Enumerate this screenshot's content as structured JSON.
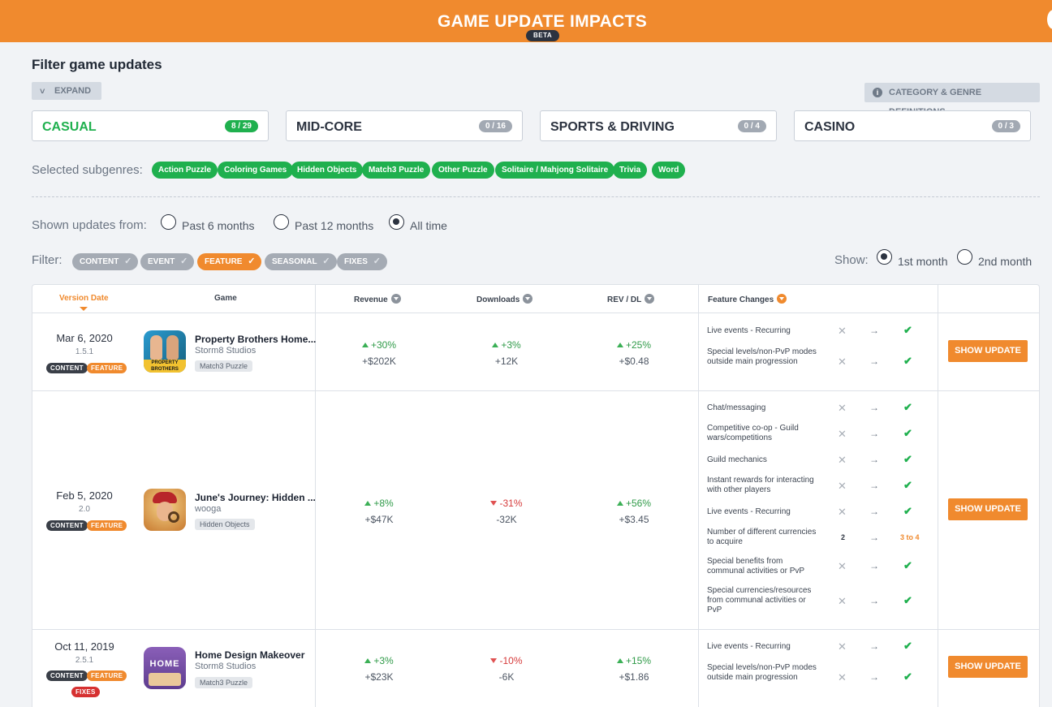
{
  "header": {
    "title": "GAME UPDATE IMPACTS",
    "beta": "BETA"
  },
  "filters": {
    "heading": "Filter game updates",
    "expand": "EXPAND",
    "definitions": "CATEGORY & GENRE DEFINITIONS",
    "categories": [
      {
        "name": "CASUAL",
        "count": "8 / 29",
        "active": true
      },
      {
        "name": "MID-CORE",
        "count": "0 / 16",
        "active": false
      },
      {
        "name": "SPORTS & DRIVING",
        "count": "0 / 4",
        "active": false
      },
      {
        "name": "CASINO",
        "count": "0 / 3",
        "active": false
      }
    ],
    "subgenres_label": "Selected subgenres:",
    "subgenres": [
      "Action Puzzle",
      "Coloring Games",
      "Hidden Objects",
      "Match3 Puzzle",
      "Other Puzzle",
      "Solitaire / Mahjong Solitaire",
      "Trivia",
      "Word"
    ],
    "shown_label": "Shown updates from:",
    "periods": [
      "Past 6 months",
      "Past 12 months",
      "All time"
    ],
    "selected_period": "All time",
    "filter_label": "Filter:",
    "types": [
      "CONTENT",
      "EVENT",
      "FEATURE",
      "SEASONAL",
      "FIXES"
    ],
    "active_type": "FEATURE",
    "show_label": "Show:",
    "months": [
      "1st month",
      "2nd month"
    ],
    "selected_month": "1st month"
  },
  "table": {
    "headers": {
      "version_date": "Version Date",
      "game": "Game",
      "revenue": "Revenue",
      "downloads": "Downloads",
      "rev_dl": "REV / DL",
      "feature_changes": "Feature Changes"
    },
    "show_update": "SHOW UPDATE",
    "rows": [
      {
        "date": "Mar 6, 2020",
        "version": "1.5.1",
        "tags": [
          "CONTENT",
          "FEATURE"
        ],
        "game": "Property Brothers Home...",
        "developer": "Storm8 Studios",
        "subgenre": "Match3 Puzzle",
        "icon_text": "PROPERTY BROTHERS",
        "revenue": {
          "pct": "+30%",
          "abs": "+$202K",
          "dir": "up"
        },
        "downloads": {
          "pct": "+3%",
          "abs": "+12K",
          "dir": "up"
        },
        "rev_dl": {
          "pct": "+25%",
          "abs": "+$0.48",
          "dir": "up"
        },
        "features": [
          {
            "label": "Live events - Recurring"
          },
          {
            "label": "Special levels/non-PvP modes outside main progression"
          }
        ]
      },
      {
        "date": "Feb 5, 2020",
        "version": "2.0",
        "tags": [
          "CONTENT",
          "FEATURE"
        ],
        "game": "June's Journey: Hidden ...",
        "developer": "wooga",
        "subgenre": "Hidden Objects",
        "revenue": {
          "pct": "+8%",
          "abs": "+$47K",
          "dir": "up"
        },
        "downloads": {
          "pct": "-31%",
          "abs": "-32K",
          "dir": "down"
        },
        "rev_dl": {
          "pct": "+56%",
          "abs": "+$3.45",
          "dir": "up"
        },
        "features": [
          {
            "label": "Chat/messaging"
          },
          {
            "label": "Competitive co-op - Guild wars/competitions"
          },
          {
            "label": "Guild mechanics"
          },
          {
            "label": "Instant rewards for interacting with other players"
          },
          {
            "label": "Live events - Recurring"
          },
          {
            "label": "Number of different currencies to acquire",
            "from": "2",
            "to": "3 to 4"
          },
          {
            "label": "Special benefits from communal activities or PvP"
          },
          {
            "label": "Special currencies/resources from communal activities or PvP"
          }
        ]
      },
      {
        "date": "Oct 11, 2019",
        "version": "2.5.1",
        "tags": [
          "CONTENT",
          "FEATURE",
          "FIXES"
        ],
        "game": "Home Design Makeover",
        "developer": "Storm8 Studios",
        "subgenre": "Match3 Puzzle",
        "icon_text": "HOME",
        "revenue": {
          "pct": "+3%",
          "abs": "+$23K",
          "dir": "up"
        },
        "downloads": {
          "pct": "-10%",
          "abs": "-6K",
          "dir": "down"
        },
        "rev_dl": {
          "pct": "+15%",
          "abs": "+$1.86",
          "dir": "up"
        },
        "features": [
          {
            "label": "Live events - Recurring"
          },
          {
            "label": "Special levels/non-PvP modes outside main progression"
          }
        ]
      }
    ]
  }
}
